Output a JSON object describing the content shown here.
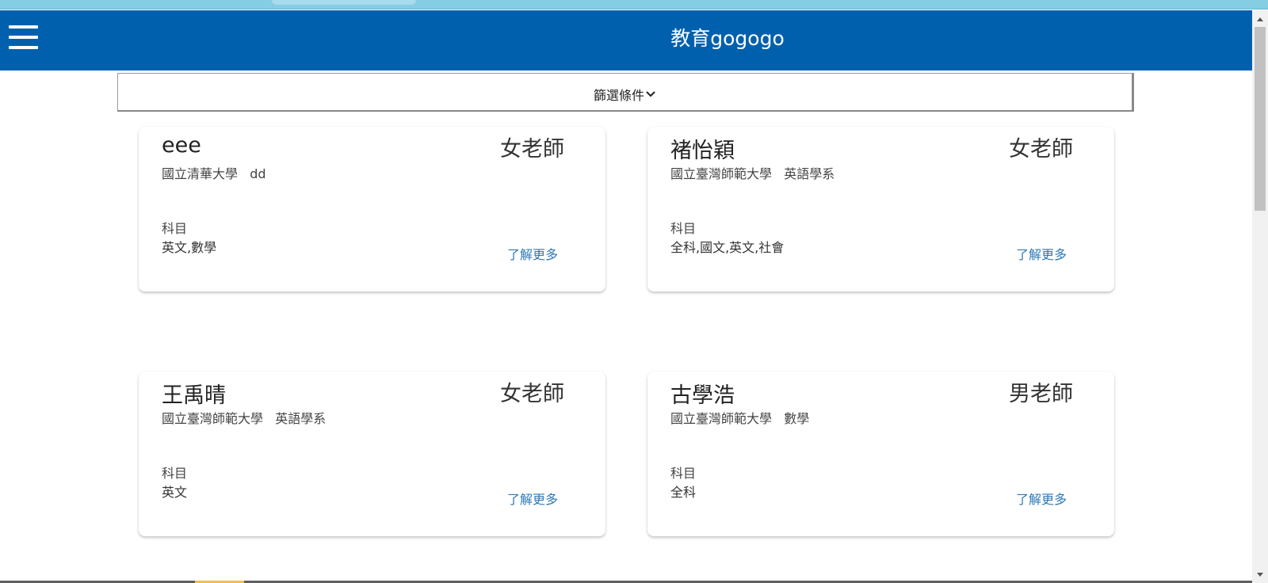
{
  "header": {
    "title": "教育gogogo",
    "menu_icon": "hamburger-menu-icon",
    "background": "#0060ae"
  },
  "filter": {
    "label": "篩選條件",
    "icon": "chevron-down-icon"
  },
  "teachers": [
    {
      "name": "eee",
      "gender": "女老師",
      "school": "國立清華大學   dd",
      "subject_label": "科目",
      "subjects": "英文,數學",
      "more_label": "了解更多"
    },
    {
      "name": "褚怡穎",
      "gender": "女老師",
      "school": "國立臺灣師範大學   英語學系",
      "subject_label": "科目",
      "subjects": "全科,國文,英文,社會",
      "more_label": "了解更多"
    },
    {
      "name": "王禹晴",
      "gender": "女老師",
      "school": "國立臺灣師範大學   英語學系",
      "subject_label": "科目",
      "subjects": "英文",
      "more_label": "了解更多"
    },
    {
      "name": "古學浩",
      "gender": "男老師",
      "school": "國立臺灣師範大學   數學",
      "subject_label": "科目",
      "subjects": "全科",
      "more_label": "了解更多"
    }
  ],
  "colors": {
    "link": "#2d78b7",
    "browser_strip": "#85cde3"
  }
}
